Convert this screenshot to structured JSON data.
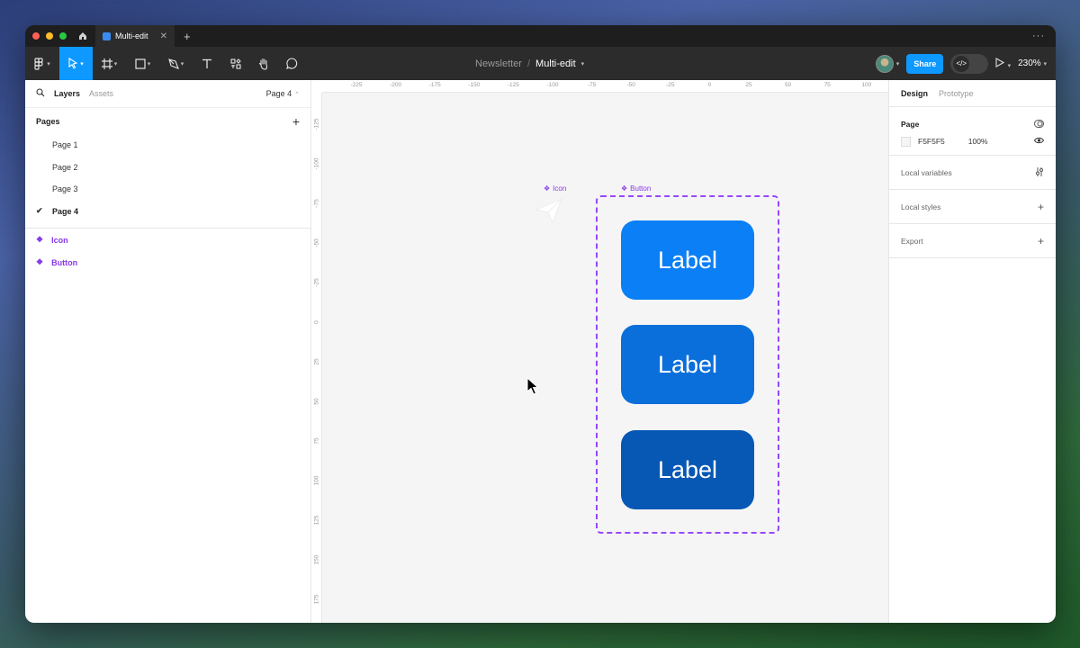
{
  "tabs": {
    "file_tab": "Multi-edit",
    "add": "+",
    "more": "···"
  },
  "traffic": {
    "colors": [
      "#ff5f57",
      "#febc2e",
      "#28c840"
    ]
  },
  "toolbar": {
    "tools": [
      "figma-menu-icon",
      "move-tool-icon",
      "frame-tool-icon",
      "shape-tool-icon",
      "pen-tool-icon",
      "text-tool-icon",
      "resources-icon",
      "hand-tool-icon",
      "comment-icon"
    ],
    "breadcrumb_project": "Newsletter",
    "breadcrumb_sep": "/",
    "breadcrumb_file": "Multi-edit",
    "share_label": "Share",
    "zoom": "230%"
  },
  "left_panel": {
    "layers_tab": "Layers",
    "assets_tab": "Assets",
    "page_selector": "Page 4",
    "pages_title": "Pages",
    "pages": [
      "Page 1",
      "Page 2",
      "Page 3",
      "Page 4"
    ],
    "current_page": "Page 4",
    "layers": [
      "Icon",
      "Button"
    ]
  },
  "canvas": {
    "ruler_top": [
      "-225",
      "-200",
      "-175",
      "-150",
      "-125",
      "-100",
      "-75",
      "-50",
      "-25",
      "0",
      "25",
      "50",
      "75",
      "100"
    ],
    "ruler_left": [
      "-125",
      "-100",
      "-75",
      "-50",
      "-25",
      "0",
      "25",
      "50",
      "75",
      "100",
      "125",
      "150",
      "175"
    ],
    "icon_label": "Icon",
    "button_label": "Button",
    "buttons": [
      {
        "label": "Label",
        "color": "#0b7ff5"
      },
      {
        "label": "Label",
        "color": "#0a6fdb"
      },
      {
        "label": "Label",
        "color": "#0757b4"
      }
    ],
    "selection_color": "#9747ff"
  },
  "right_panel": {
    "design_tab": "Design",
    "prototype_tab": "Prototype",
    "page_section": "Page",
    "page_color": "F5F5F5",
    "page_opacity": "100%",
    "local_variables": "Local variables",
    "local_styles": "Local styles",
    "export": "Export"
  }
}
